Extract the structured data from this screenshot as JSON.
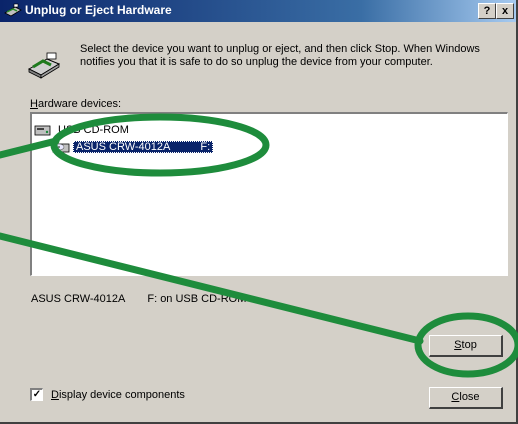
{
  "window": {
    "title": "Unplug or Eject Hardware",
    "help_button": "?",
    "close_button": "x"
  },
  "instructions": "Select the device you want to unplug or eject, and then click Stop. When Windows notifies you that it is safe to do so unplug the device from your computer.",
  "hardware_label": {
    "hotkey": "H",
    "rest": "ardware devices:"
  },
  "tree": {
    "root": {
      "label": "USB CD-ROM",
      "icon": "usb-device-icon"
    },
    "child": {
      "label": "ASUS CRW-4012A",
      "drive": "F:",
      "icon": "cd-drive-icon",
      "selected": true
    }
  },
  "status": {
    "device": "ASUS CRW-4012A",
    "location": "F: on USB CD-ROM"
  },
  "buttons": {
    "stop": {
      "hotkey": "S",
      "rest": "top"
    },
    "close": {
      "hotkey": "C",
      "rest": "lose"
    }
  },
  "checkbox": {
    "checked": true,
    "hotkey": "D",
    "rest": "isplay device components"
  },
  "annotation": {
    "color": "#1e8c3c",
    "shape": "ellipse-and-pointer-lines"
  },
  "colors": {
    "titlebar": "#0a246a",
    "selection": "#0a246a",
    "dialog": "#d4d0c8"
  }
}
